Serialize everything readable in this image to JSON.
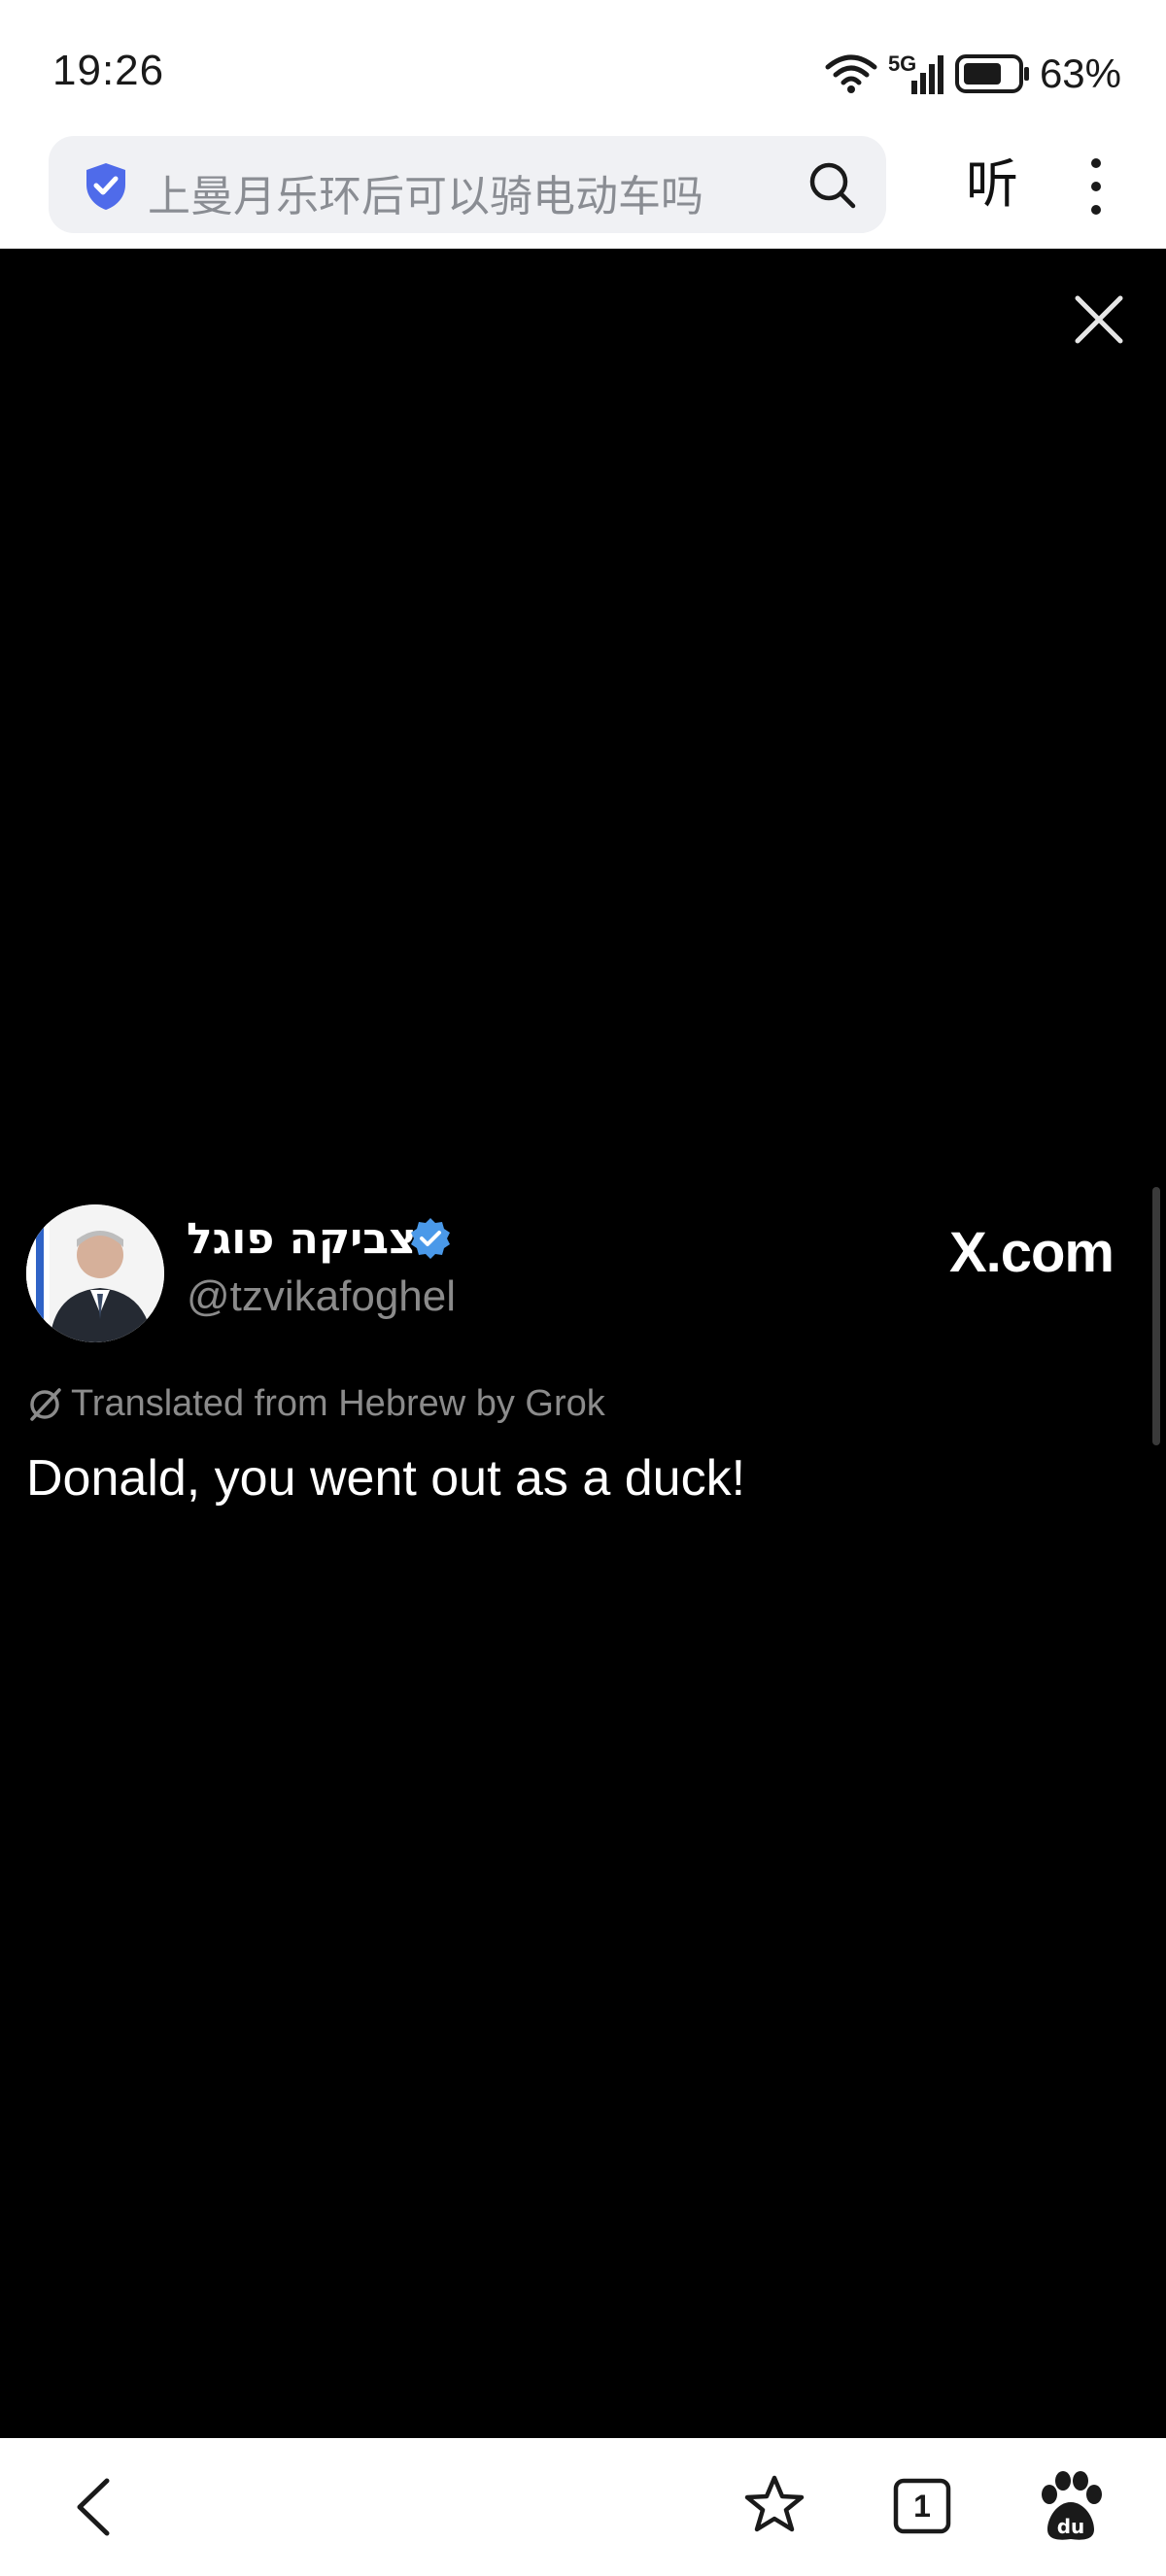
{
  "status_bar": {
    "time": "19:26",
    "network": "5G",
    "battery_percent": "63%",
    "icons": [
      "wifi-icon",
      "signal-icon",
      "battery-icon"
    ]
  },
  "browser": {
    "search_text": "上曼月乐环后可以骑电动车吗",
    "listen_label": "听",
    "icons": [
      "shield-icon",
      "search-icon",
      "more-icon"
    ]
  },
  "post": {
    "author_name": "צביקה פוגל",
    "author_handle": "@tzvikafoghel",
    "site_logo": "X.com",
    "translation_note": "Translated from Hebrew by Grok",
    "text": "Donald, you went out as a duck!"
  },
  "bottom_nav": {
    "tab_count": "1",
    "icons": [
      "back-icon",
      "star-icon",
      "tabs-icon",
      "baidu-paw-icon"
    ]
  },
  "colors": {
    "accent_blue": "#4f6bea",
    "verified_blue": "#4a99e9",
    "muted_text": "#8b8b8b"
  }
}
